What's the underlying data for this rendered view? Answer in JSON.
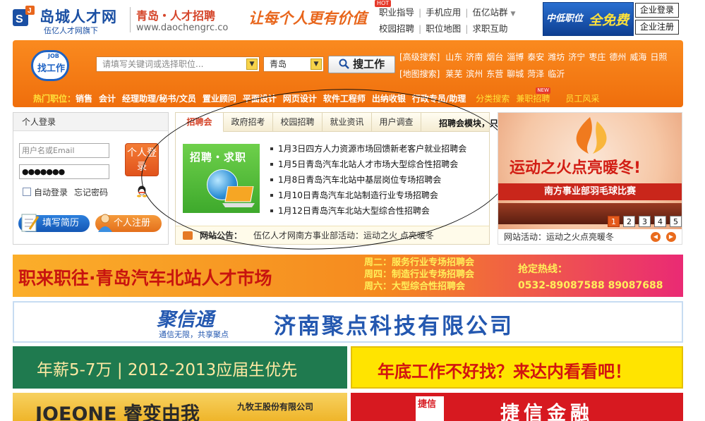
{
  "header": {
    "logo_name": "岛城人才网",
    "logo_sub": "伍亿人才网旗下",
    "site_name": "青岛・人才招聘",
    "site_url": "www.daochengrc.co",
    "slogan": "让每个人更有价值",
    "hot_badge": "HOT",
    "nav_row1": [
      "职业指导",
      "手机应用",
      "伍亿站群"
    ],
    "nav_row2": [
      "校园招聘",
      "职位地图",
      "求职互助"
    ],
    "free_banner": {
      "part1": "中低职位",
      "part2": "全免费"
    },
    "ent_login": "企业登录",
    "ent_register": "企业注册"
  },
  "search": {
    "badge_char": "找",
    "badge_text": "工作",
    "badge_job": "JOB",
    "keyword_placeholder": "请填写关键词或选择职位...",
    "city_value": "青岛",
    "search_button": "搜工作",
    "advanced_label": "[高级搜索]",
    "map_label": "[地图搜索]",
    "cities_row1": [
      "山东",
      "济南",
      "烟台",
      "淄博",
      "泰安",
      "潍坊",
      "济宁",
      "枣庄",
      "德州",
      "威海",
      "日照"
    ],
    "cities_row2": [
      "莱芜",
      "滨州",
      "东营",
      "聊城",
      "菏泽",
      "临沂"
    ]
  },
  "hot_positions": {
    "label": "热门职位：",
    "items": [
      "销售",
      "会计",
      "经理助理/秘书/文员",
      "置业顾问",
      "平面设计",
      "网页设计",
      "软件工程师",
      "出纳收银",
      "行政专员/助理"
    ],
    "extra": [
      "分类搜索",
      "兼职招聘",
      "员工风采"
    ],
    "new_badge": "NEW"
  },
  "login": {
    "title": "个人登录",
    "username_placeholder": "用户名或Email",
    "password_mask": "●●●●●●●",
    "login_button": "个人登录",
    "auto_login": "自动登录",
    "forgot": "忘记密码",
    "resume_button": "填写简历",
    "register_button": "个人注册"
  },
  "tabs": {
    "items": [
      "招聘会",
      "政府招考",
      "校园招聘",
      "就业资讯",
      "用户调查"
    ],
    "image_title": "招聘・求职",
    "news": [
      "1月3日四方人力资源市场回馈新老客户就业招聘会",
      "1月5日青岛汽车北站人才市场大型综合性招聘会",
      "1月8日青岛汽车北站中基层岗位专场招聘会",
      "1月10日青岛汽车北站制造行业专场招聘会",
      "1月12日青岛汽车北站大型综合性招聘会"
    ],
    "notice_label": "网站公告：",
    "notice_text": "伍亿人才网南方事业部活动：运动之火 点亮暖冬"
  },
  "annotation": "招聘会模块，只要一个页面",
  "promo": {
    "line1": "运动之火点亮暖冬!",
    "line2": "南方事业部羽毛球比赛",
    "pages": [
      "1",
      "2",
      "3",
      "4",
      "5"
    ],
    "active_page": "1",
    "caption": "网站活动：运动之火点亮暖冬"
  },
  "banners": {
    "b1_title": "职来职往·青岛汽车北站人才市场",
    "b1_days": [
      "周二：服务行业专场招聘会",
      "周四：制造行业专场招聘会",
      "周六：大型综合性招聘会"
    ],
    "b1_hotline": "抢定热线：",
    "b1_phone": "0532-89087588   89087688",
    "b2_brand": "聚信通",
    "b2_tag": "通信无限，共享聚点",
    "b2_company": "济南聚点科技有限公司",
    "b3_text": "年薪5-7万 | 2012-2013应届生优先",
    "b4_text": "年底工作不好找？来达内看看吧！",
    "b5_text": "JOEONE 睿变由我",
    "b5_sub": "九牧王股份有限公司",
    "b6_logo": "捷信",
    "b6_text": "捷信金融"
  }
}
